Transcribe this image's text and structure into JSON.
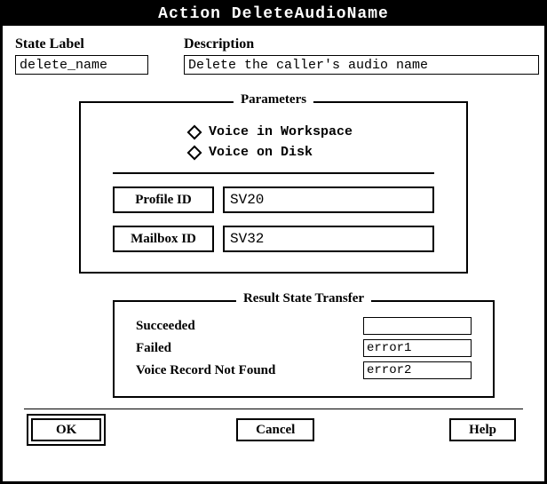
{
  "title": "Action DeleteAudioName",
  "state": {
    "label": "State Label",
    "value": "delete_name"
  },
  "desc": {
    "label": "Description",
    "value": "Delete the caller's audio name"
  },
  "params": {
    "legend": "Parameters",
    "radios": {
      "workspace": "Voice in Workspace",
      "disk": "Voice on Disk"
    },
    "profile": {
      "label": "Profile ID",
      "value": "SV20"
    },
    "mailbox": {
      "label": "Mailbox ID",
      "value": "SV32"
    }
  },
  "rst": {
    "legend": "Result State Transfer",
    "succeeded": {
      "label": "Succeeded",
      "value": ""
    },
    "failed": {
      "label": "Failed",
      "value": "error1"
    },
    "notfound": {
      "label": "Voice Record Not Found",
      "value": "error2"
    }
  },
  "buttons": {
    "ok": "OK",
    "cancel": "Cancel",
    "help": "Help"
  }
}
